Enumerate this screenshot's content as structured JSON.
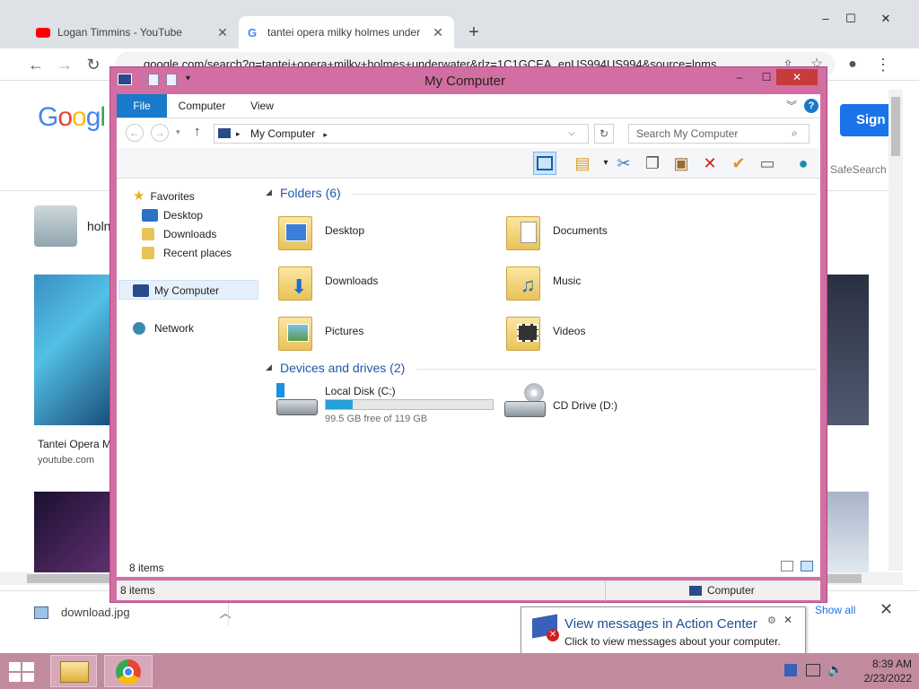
{
  "browser": {
    "tabs": [
      {
        "title": "Logan Timmins - YouTube",
        "icon": "youtube-icon"
      },
      {
        "title": "tantei opera milky holmes under",
        "icon": "google-icon"
      }
    ],
    "url": "google.com/search?q=tantei+opera+milky+holmes+underwater&rlz=1C1GCEA_enUS994US994&source=lnms",
    "sign_in": "Sign i",
    "safesearch": "SafeSearch",
    "result_snippet": "holn",
    "caption_title": "Tantei Opera M",
    "caption_source": "youtube.com",
    "download": {
      "file": "download.jpg",
      "show_all": "Show all"
    }
  },
  "explorer": {
    "title": "My Computer",
    "ribbon_tabs": [
      "File",
      "Computer",
      "View"
    ],
    "address": "My Computer",
    "search_placeholder": "Search My Computer",
    "nav": {
      "favorites": "Favorites",
      "fav_items": [
        "Desktop",
        "Downloads",
        "Recent places"
      ],
      "my_computer": "My Computer",
      "network": "Network"
    },
    "folders_header": "Folders (6)",
    "folders": [
      "Desktop",
      "Documents",
      "Downloads",
      "Music",
      "Pictures",
      "Videos"
    ],
    "devices_header": "Devices and drives (2)",
    "drives": [
      {
        "name": "Local Disk (C:)",
        "free": "99.5 GB free of 119 GB",
        "used_fraction": 0.16
      },
      {
        "name": "CD Drive (D:)"
      }
    ],
    "item_count": "8 items",
    "status_count": "8 items",
    "status_location": "Computer"
  },
  "notification": {
    "title": "View messages in Action Center",
    "message": "Click to view messages about your computer."
  },
  "taskbar": {
    "time": "8:39 AM",
    "date": "2/23/2022"
  }
}
